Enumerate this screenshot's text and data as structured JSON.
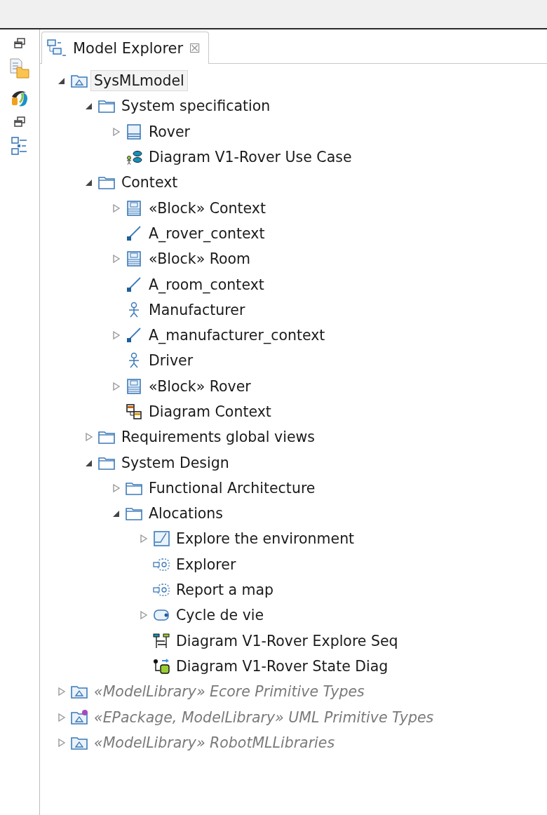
{
  "side_toolbar": [
    {
      "kind": "restore"
    },
    {
      "kind": "files"
    },
    {
      "kind": "logo"
    },
    {
      "kind": "restore"
    },
    {
      "kind": "outline"
    }
  ],
  "tab": {
    "title": "Model Explorer",
    "close": "☒"
  },
  "tree": [
    {
      "label": "SysMLmodel",
      "kind": "model",
      "library": false,
      "selected": true,
      "expanded": true,
      "children": [
        {
          "label": "System specification",
          "kind": "folder",
          "expanded": true,
          "children": [
            {
              "label": "Rover",
              "kind": "block",
              "expanded": false
            },
            {
              "label": "Diagram V1-Rover Use Case",
              "kind": "usecase-diagram"
            }
          ]
        },
        {
          "label": "Context",
          "kind": "folder",
          "expanded": true,
          "children": [
            {
              "label": "«Block» Context",
              "kind": "stereo-block",
              "expanded": false
            },
            {
              "label": "A_rover_context",
              "kind": "association"
            },
            {
              "label": "«Block» Room",
              "kind": "stereo-block",
              "expanded": false
            },
            {
              "label": "A_room_context",
              "kind": "association"
            },
            {
              "label": "Manufacturer",
              "kind": "actor"
            },
            {
              "label": "A_manufacturer_context",
              "kind": "association",
              "expanded": false
            },
            {
              "label": "Driver",
              "kind": "actor"
            },
            {
              "label": "«Block» Rover",
              "kind": "stereo-block",
              "expanded": false
            },
            {
              "label": "Diagram Context",
              "kind": "ibd"
            }
          ]
        },
        {
          "label": "Requirements global views",
          "kind": "folder",
          "expanded": false
        },
        {
          "label": "System Design",
          "kind": "folder",
          "expanded": true,
          "children": [
            {
              "label": "Functional Architecture",
              "kind": "folder",
              "expanded": false
            },
            {
              "label": "Alocations",
              "kind": "folder",
              "expanded": true,
              "children": [
                {
                  "label": "Explore the environment",
                  "kind": "activity",
                  "expanded": false
                },
                {
                  "label": "Explorer",
                  "kind": "part"
                },
                {
                  "label": "Report a map",
                  "kind": "part"
                },
                {
                  "label": "Cycle de vie",
                  "kind": "state-machine",
                  "expanded": false
                },
                {
                  "label": "Diagram V1-Rover Explore Seq",
                  "kind": "sequence-diagram"
                },
                {
                  "label": "Diagram V1-Rover State Diag",
                  "kind": "state-diagram"
                }
              ]
            }
          ]
        }
      ]
    },
    {
      "label": "«ModelLibrary» Ecore Primitive Types",
      "kind": "model",
      "library": true,
      "selected": false,
      "expanded": false
    },
    {
      "label": "«EPackage, ModelLibrary» UML Primitive Types",
      "kind": "epackage",
      "library": true,
      "selected": false,
      "expanded": false
    },
    {
      "label": "«ModelLibrary» RobotMLLibraries",
      "kind": "model",
      "library": true,
      "selected": false,
      "expanded": false
    }
  ]
}
